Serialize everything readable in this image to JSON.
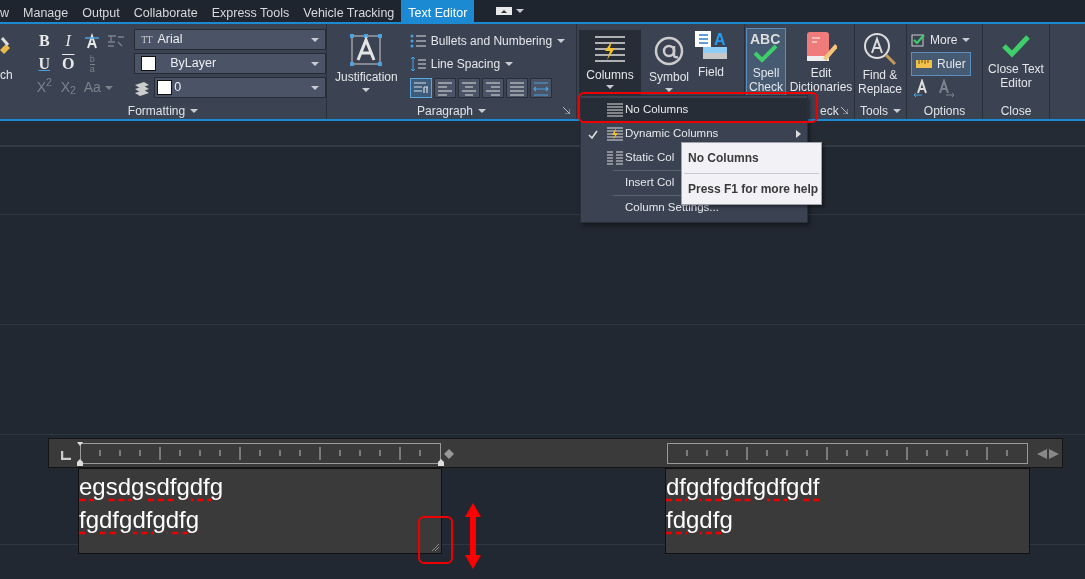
{
  "ribbon_tabs": [
    {
      "label": "w",
      "selected": false
    },
    {
      "label": "Manage",
      "selected": false
    },
    {
      "label": "Output",
      "selected": false
    },
    {
      "label": "Collaborate",
      "selected": false
    },
    {
      "label": "Express Tools",
      "selected": false
    },
    {
      "label": "Vehicle Tracking",
      "selected": false
    },
    {
      "label": "Text Editor",
      "selected": true
    }
  ],
  "formatting_panel": {
    "partial_button": "ch",
    "rows": [
      [
        {
          "kind": "text",
          "label": "B",
          "disabled": false
        },
        {
          "kind": "text",
          "label": "I",
          "disabled": false
        },
        {
          "kind": "strike",
          "disabled": false
        },
        {
          "kind": "style",
          "disabled": true
        }
      ],
      [
        {
          "kind": "text",
          "label": "U",
          "disabled": false
        },
        {
          "kind": "text",
          "label": "O",
          "disabled": false
        },
        {
          "kind": "stack",
          "top": "b",
          "bottom": "a",
          "disabled": true
        }
      ],
      [
        {
          "kind": "text",
          "label": "X$^{2}$",
          "disabled": true
        },
        {
          "kind": "text",
          "label": "X$_{2}$",
          "disabled": true
        },
        {
          "kind": "text",
          "label": "Aa",
          "disabled": true
        }
      ]
    ],
    "font_icon": "TT",
    "font": "Arial",
    "color_setting": "ByLayer",
    "layer": "0",
    "title": "Formatting"
  },
  "paragraph_panel": {
    "justification": "Justification",
    "bullets": "Bullets and Numbering",
    "line_spacing": "Line Spacing",
    "alignments": [
      {
        "kind": "default",
        "selected": true
      },
      {
        "kind": "left",
        "selected": false
      },
      {
        "kind": "center",
        "selected": false
      },
      {
        "kind": "right",
        "selected": false
      },
      {
        "kind": "justify",
        "selected": false
      },
      {
        "kind": "distribute",
        "selected": false
      }
    ],
    "title": "Paragraph"
  },
  "insert_panel": {
    "columns": "Columns",
    "symbol": "Symbol",
    "field_icon": "A",
    "field": "Field"
  },
  "spelling_panel": {
    "spell_check_icon": "ABC",
    "spell_check": "Spell Check",
    "spell_check_on": true,
    "edit_dictionaries": "Edit Dictionaries",
    "title": "eck"
  },
  "tools_panel": {
    "find_replace": "Find & Replace",
    "title": "Tools"
  },
  "options_panel": {
    "more": "More",
    "ruler": "Ruler",
    "ruler_on": true,
    "title": "Options"
  },
  "close_panel": {
    "close": "Close Text Editor",
    "title": "Close"
  },
  "columns_menu": [
    {
      "label": "No Columns",
      "kind": "none",
      "checked": false,
      "selected": true,
      "submenu": false
    },
    {
      "label": "Dynamic Columns",
      "kind": "dynamic",
      "checked": true,
      "selected": false,
      "submenu": true
    },
    {
      "label": "Static Col",
      "kind": "static",
      "checked": false,
      "selected": false,
      "submenu": false
    },
    {
      "label": "Insert Col",
      "kind": "plain",
      "checked": false,
      "selected": false,
      "submenu": false
    },
    {
      "label": "Column Settings...",
      "kind": "plain",
      "checked": false,
      "selected": false,
      "submenu": false
    }
  ],
  "tooltip": {
    "title": "No Columns",
    "help": "Press F1 for more help"
  },
  "editors": [
    {
      "lines": [
        "egsdgsdfgdfg",
        "fgdfgdfgdfg"
      ]
    },
    {
      "lines": [
        "dfgdfgdfgdfgdf",
        "fdgdfg"
      ]
    }
  ]
}
